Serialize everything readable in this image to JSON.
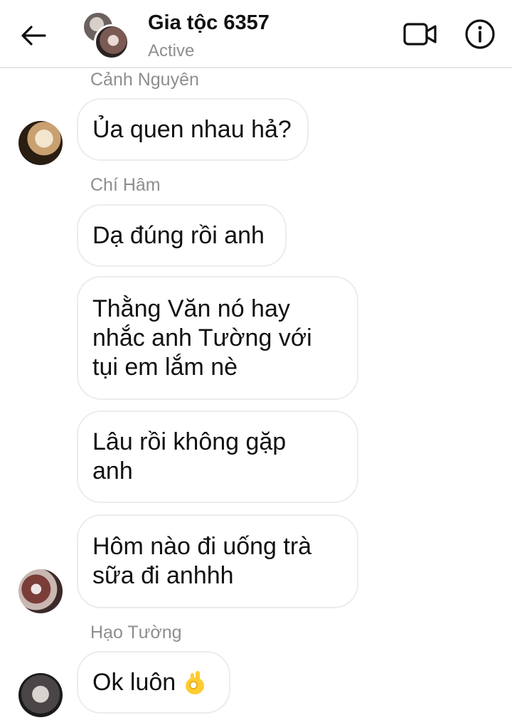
{
  "header": {
    "title": "Gia tộc 6357",
    "status": "Active",
    "back_icon": "back-arrow-icon",
    "call_icon": "video-camera-icon",
    "info_icon": "info-icon"
  },
  "messages": [
    {
      "sender": "Cảnh Nguyên",
      "text": "Ủa quen nhau hả?"
    },
    {
      "sender": "Chí Hâm",
      "text": "Dạ đúng rồi anh"
    },
    {
      "sender": "Chí Hâm",
      "text": "Thằng Văn nó hay\nnhắc anh Tường với\ntụi em lắm nè"
    },
    {
      "sender": "Chí Hâm",
      "text": "Lâu rồi không gặp\nanh"
    },
    {
      "sender": "Chí Hâm",
      "text": "Hôm nào đi uống trà\nsữa đi anhhh"
    },
    {
      "sender": "Hạo Tường",
      "text": "Ok luôn",
      "emoji": "ok-hand-emoji"
    }
  ],
  "colors": {
    "bubble_border": "#ececec",
    "secondary_text": "#8e8e8e",
    "emoji_yellow": "#ffcc33"
  }
}
